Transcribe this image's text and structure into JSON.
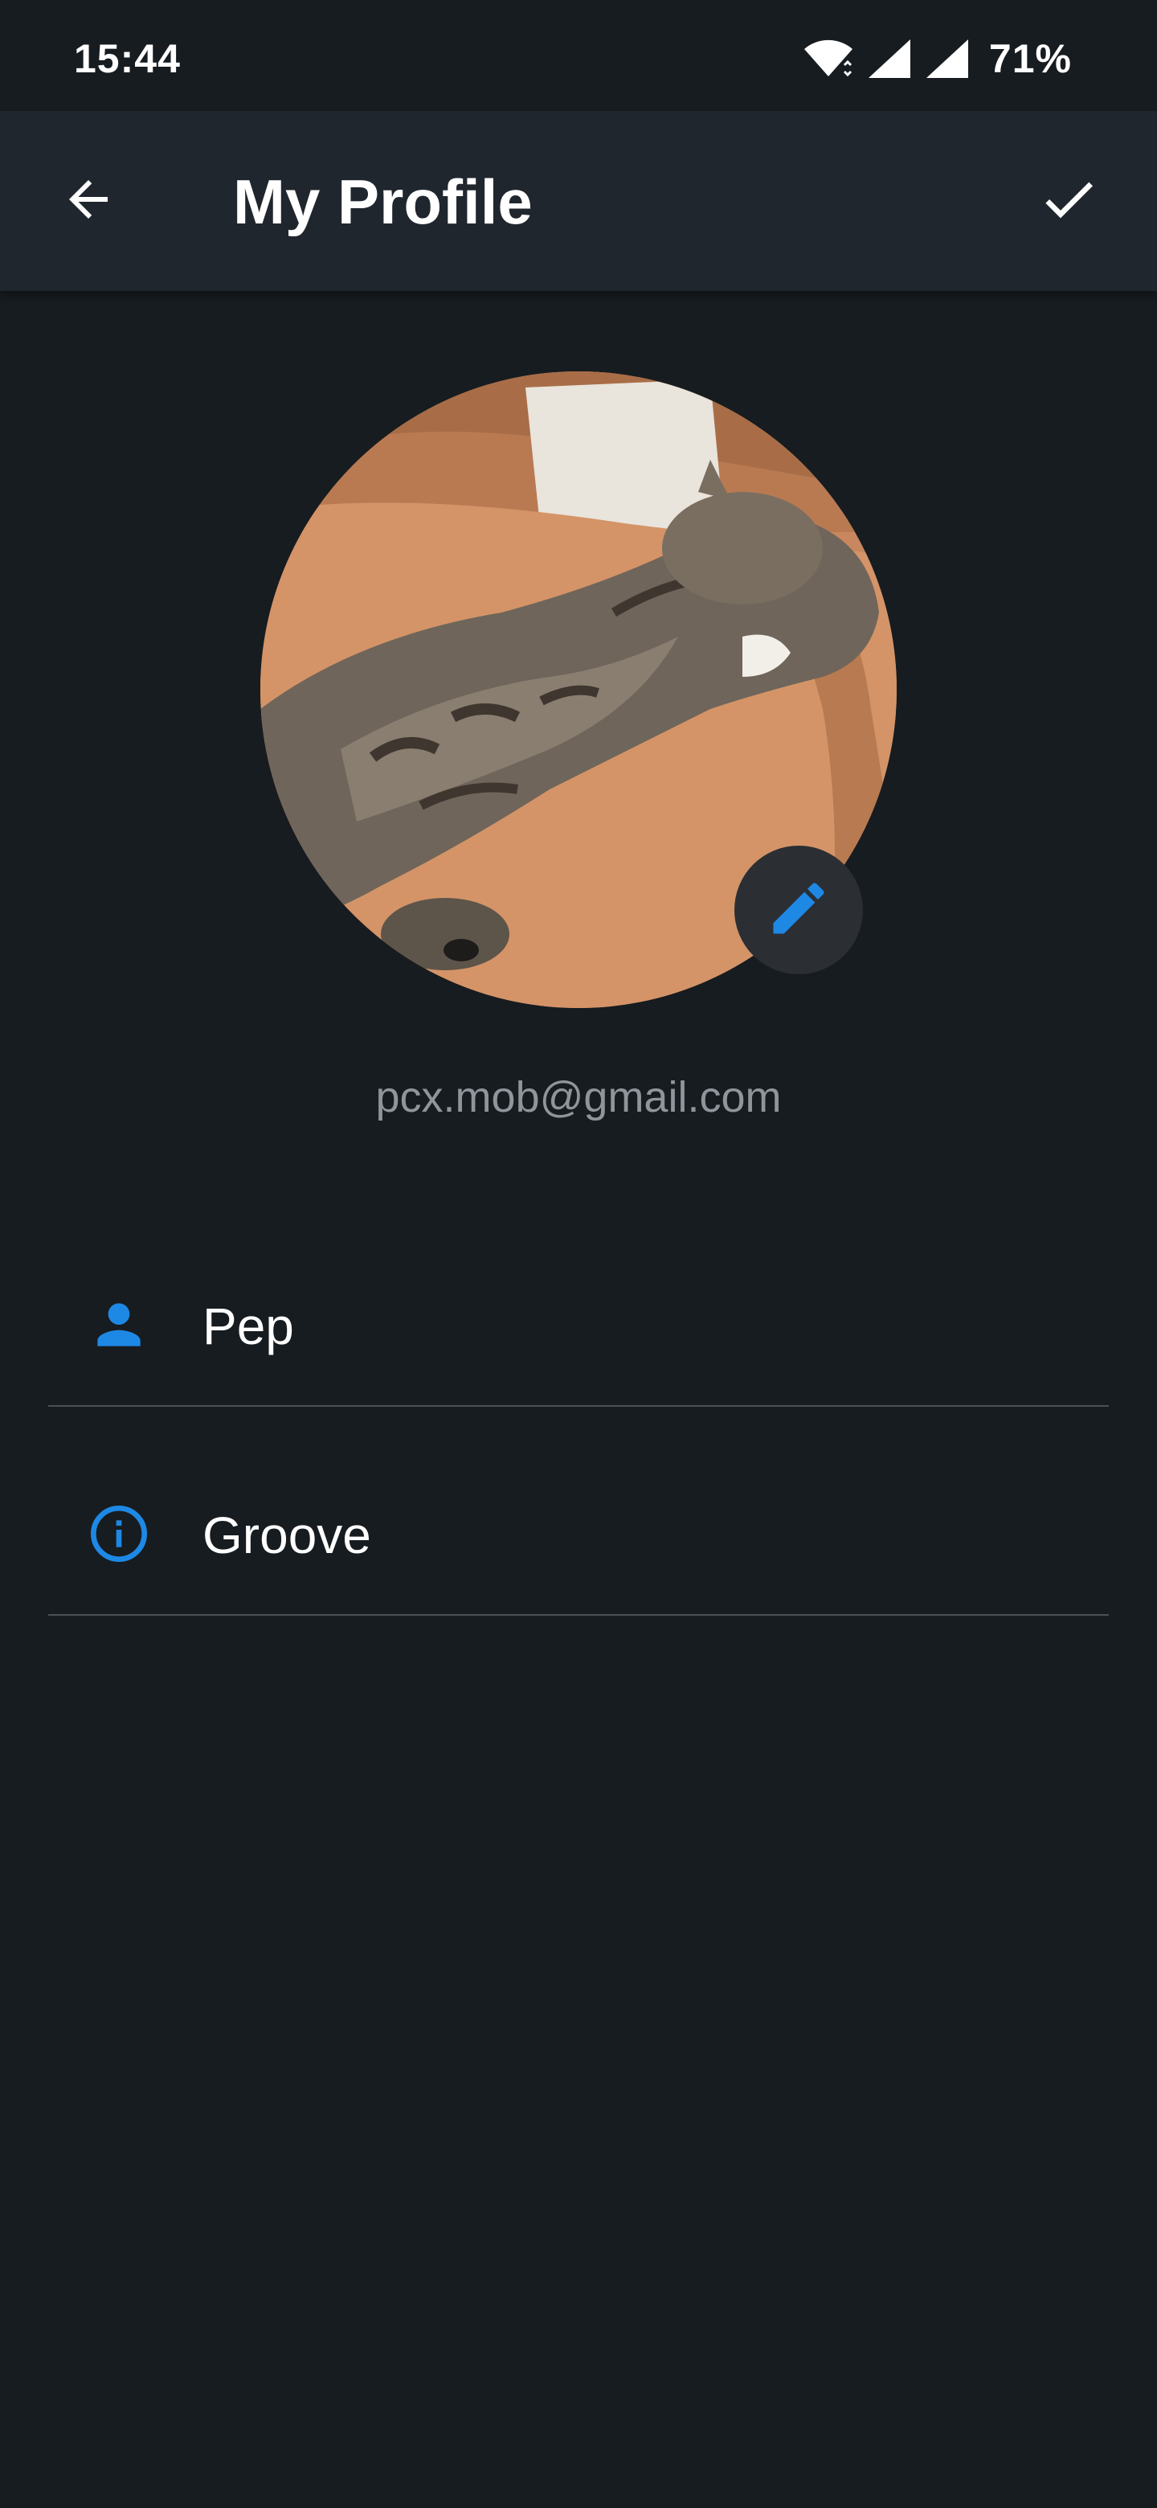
{
  "status_bar": {
    "time": "15:44",
    "battery": "71%",
    "icons": [
      "wifi-icon",
      "signal-icon",
      "signal-icon"
    ]
  },
  "toolbar": {
    "title": "My Profile",
    "back_icon": "arrow-left-icon",
    "save_icon": "check-icon"
  },
  "profile": {
    "avatar": "cat-lying-on-sofa-photo",
    "edit_icon": "pencil-icon",
    "email": "pcx.mob@gmail.com"
  },
  "fields": [
    {
      "icon": "person-icon",
      "value": "Pep"
    },
    {
      "icon": "info-icon",
      "value": "Groove"
    }
  ],
  "colors": {
    "background": "#171c20",
    "toolbar": "#20262e",
    "accent": "#1e88e5",
    "secondary_text": "#8f959b",
    "divider": "#4a5055"
  }
}
